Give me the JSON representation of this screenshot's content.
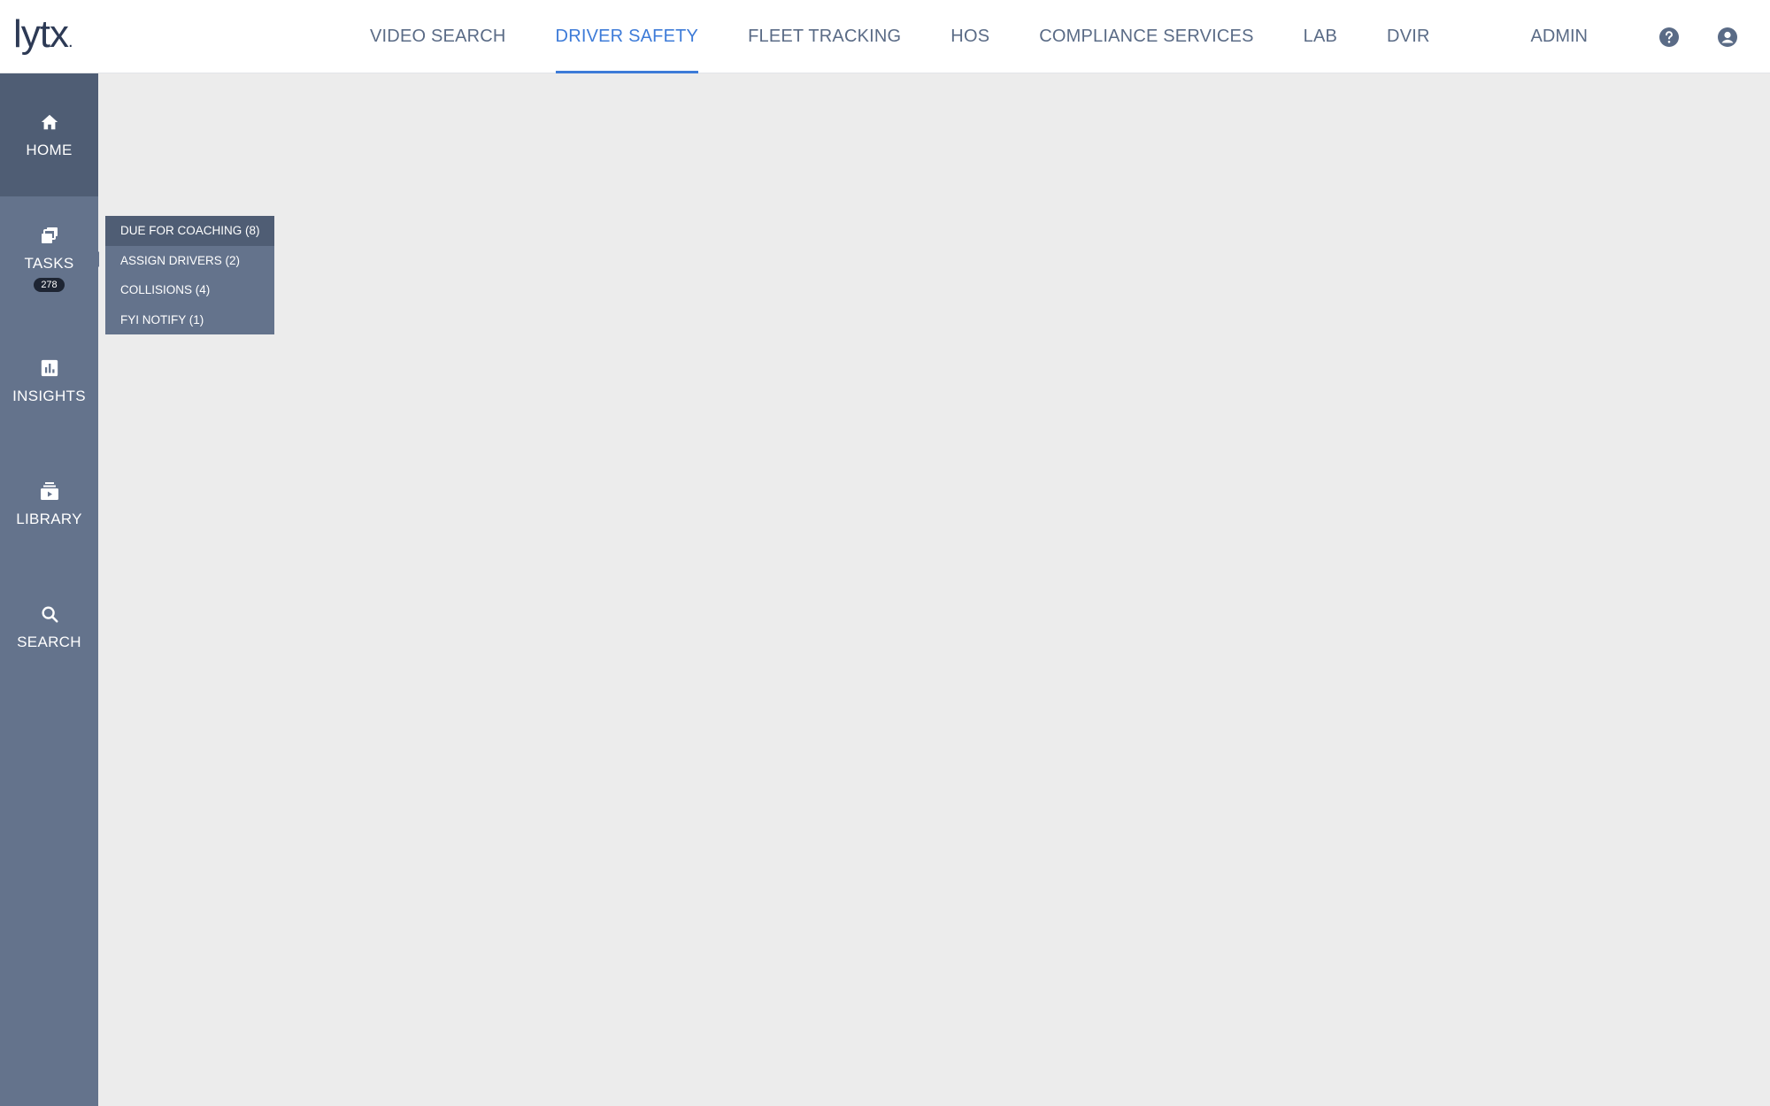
{
  "brand": {
    "logo_text": "lytx",
    "logo_mark": "."
  },
  "topnav": {
    "items": [
      {
        "label": "VIDEO SEARCH",
        "active": false
      },
      {
        "label": "DRIVER SAFETY",
        "active": true
      },
      {
        "label": "FLEET TRACKING",
        "active": false
      },
      {
        "label": "HOS",
        "active": false
      },
      {
        "label": "COMPLIANCE SERVICES",
        "active": false
      },
      {
        "label": "LAB",
        "active": false
      },
      {
        "label": "DVIR",
        "active": false
      }
    ],
    "admin_label": "ADMIN",
    "help_icon": "help-circle-icon",
    "account_icon": "account-circle-icon"
  },
  "sidebar": {
    "items": [
      {
        "label": "HOME",
        "icon": "home-icon",
        "active": true
      },
      {
        "label": "TASKS",
        "icon": "tasks-icon",
        "badge": "278"
      },
      {
        "label": "INSIGHTS",
        "icon": "insights-chart-icon"
      },
      {
        "label": "LIBRARY",
        "icon": "video-library-icon"
      },
      {
        "label": "SEARCH",
        "icon": "search-icon"
      }
    ]
  },
  "tasks_flyout": {
    "items": [
      {
        "label": "DUE FOR COACHING (8)",
        "active": true
      },
      {
        "label": "ASSIGN DRIVERS (2)"
      },
      {
        "label": "COLLISIONS (4)"
      },
      {
        "label": "FYI NOTIFY (1)"
      }
    ]
  },
  "colors": {
    "accent": "#3d7bd8",
    "sidebar": "#64738c",
    "sidebar_active": "#4f5d74",
    "nav_text": "#5a6b86",
    "background": "#ececec"
  }
}
